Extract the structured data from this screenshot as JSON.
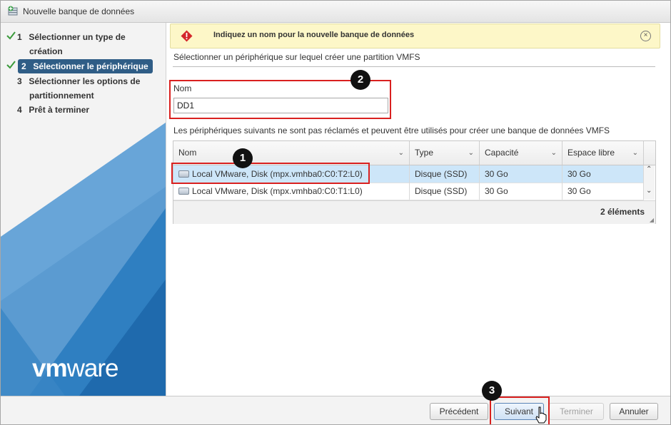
{
  "window": {
    "title": "Nouvelle banque de données"
  },
  "steps": [
    {
      "num": "1",
      "line1": "Sélectionner un type de",
      "line2": "création",
      "done": true
    },
    {
      "num": "2",
      "line1": "Sélectionner le périphérique",
      "done": true,
      "active": true
    },
    {
      "num": "3",
      "line1": "Sélectionner les options de",
      "line2": "partitionnement"
    },
    {
      "num": "4",
      "line1": "Prêt à terminer"
    }
  ],
  "brand": {
    "logo_prefix": "vm",
    "logo_suffix": "ware",
    "sidebar_accent": "#1f73b7"
  },
  "warning": {
    "text": "Indiquez un nom pour la nouvelle banque de données",
    "color": "#fdf7c8",
    "close_glyph": "×"
  },
  "page": {
    "subtitle": "Sélectionner un périphérique sur lequel créer une partition VMFS"
  },
  "name_field": {
    "label": "Nom",
    "value": "DD1"
  },
  "devices": {
    "description": "Les périphériques suivants ne sont pas réclamés et peuvent être utilisés pour créer une banque de données VMFS",
    "columns": [
      "Nom",
      "Type",
      "Capacité",
      "Espace libre"
    ],
    "rows": [
      {
        "name": "Local VMware, Disk (mpx.vmhba0:C0:T2:L0)",
        "type": "Disque (SSD)",
        "capacity": "30 Go",
        "free": "30 Go",
        "selected": true
      },
      {
        "name": "Local VMware, Disk (mpx.vmhba0:C0:T1:L0)",
        "type": "Disque (SSD)",
        "capacity": "30 Go",
        "free": "30 Go"
      }
    ],
    "count_label": "2 éléments"
  },
  "buttons": {
    "previous": "Précédent",
    "next": "Suivant",
    "finish": "Terminer",
    "cancel": "Annuler"
  },
  "callouts": [
    "1",
    "2",
    "3"
  ],
  "colors": {
    "highlight": "#d9201f",
    "selection": "#cde6f9",
    "active_step": "#2f5d86"
  }
}
